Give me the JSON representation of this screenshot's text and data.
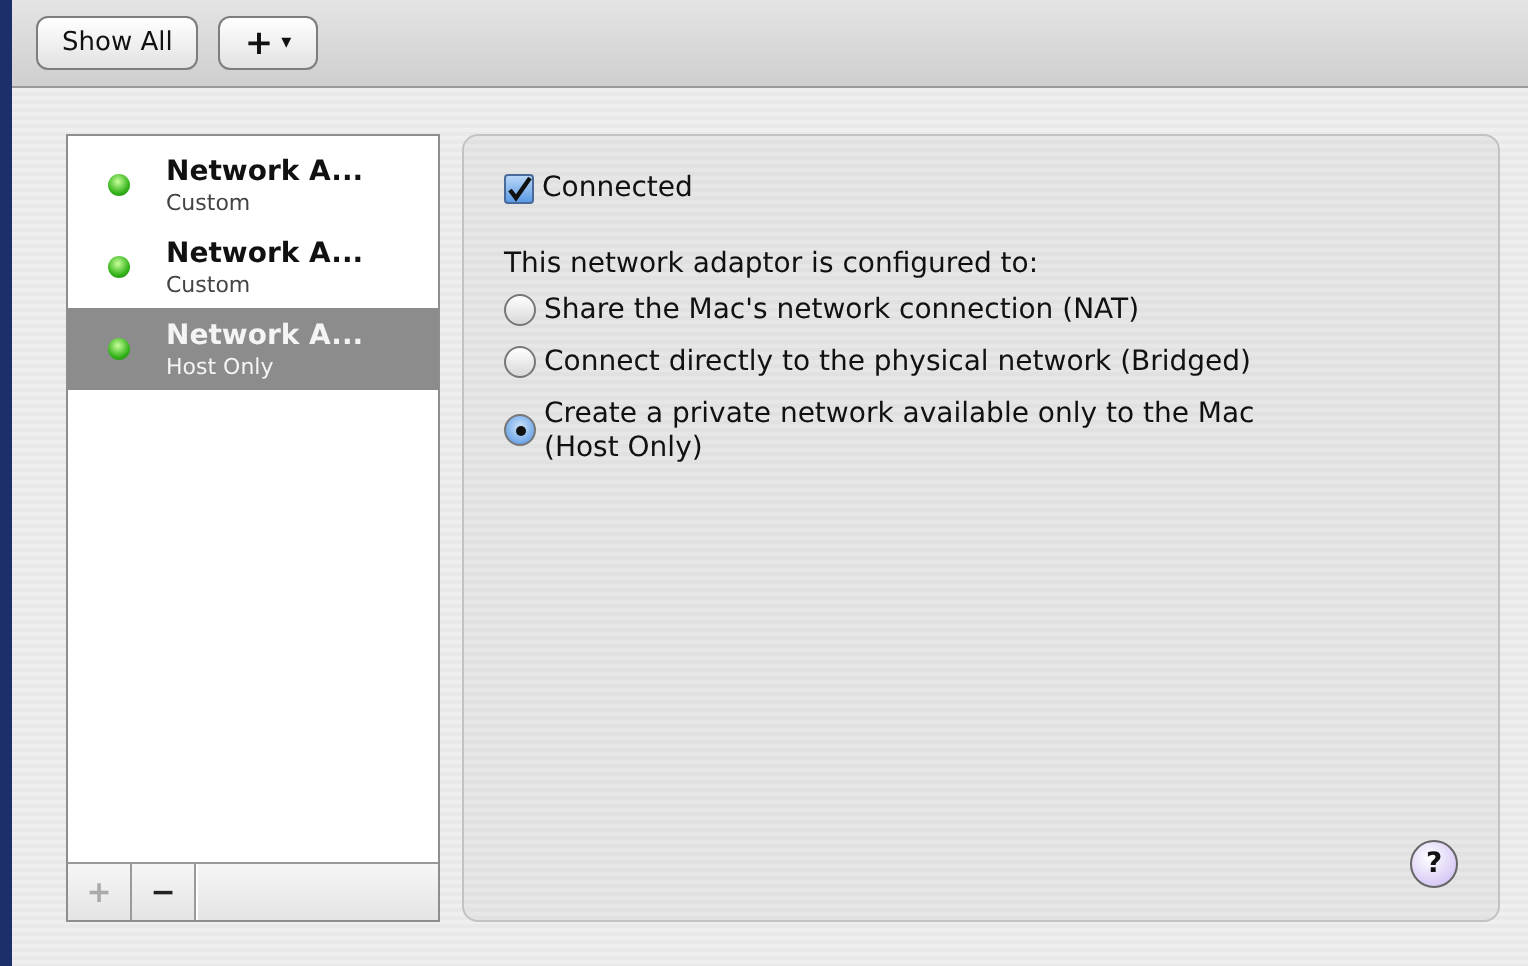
{
  "toolbar": {
    "show_all": "Show All",
    "add_menu": {
      "label": "+",
      "caret": "▾"
    }
  },
  "adapters": [
    {
      "name": "Network A...",
      "type": "Custom",
      "connected": true,
      "selected": false
    },
    {
      "name": "Network A...",
      "type": "Custom",
      "connected": true,
      "selected": false
    },
    {
      "name": "Network A...",
      "type": "Host Only",
      "connected": true,
      "selected": true
    }
  ],
  "list_buttons": [
    {
      "label": "+",
      "disabled": true
    },
    {
      "label": "−",
      "disabled": false
    }
  ],
  "connected": {
    "label": "Connected",
    "checked": true
  },
  "config_label": "This network adaptor is configured to:",
  "options": [
    {
      "label": "Share the Mac's network connection (NAT)",
      "selected": false
    },
    {
      "label": "Connect directly to the physical network (Bridged)",
      "selected": false
    },
    {
      "label": "Create a private network available only to the Mac (Host Only)",
      "selected": true
    }
  ],
  "help": "?"
}
